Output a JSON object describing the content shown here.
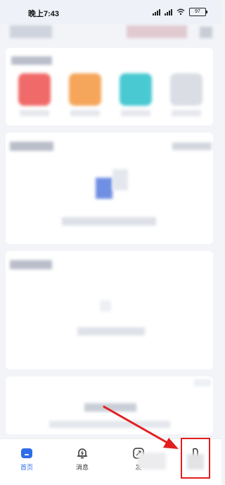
{
  "status_bar": {
    "time": "晚上7:43",
    "battery": "97"
  },
  "tabs": [
    {
      "label": "首页",
      "icon": "home-icon",
      "active": true
    },
    {
      "label": "消息",
      "icon": "bell-icon",
      "active": false
    },
    {
      "label": "发",
      "icon": "publish-icon",
      "active": false
    },
    {
      "label": "",
      "icon": "profile-icon",
      "active": false
    }
  ],
  "colors": {
    "accent": "#2f6de8",
    "tile_red": "#f06a6a",
    "tile_orange": "#f5a65a",
    "tile_cyan": "#49c9d2",
    "annotation_red": "#e11f1f"
  }
}
